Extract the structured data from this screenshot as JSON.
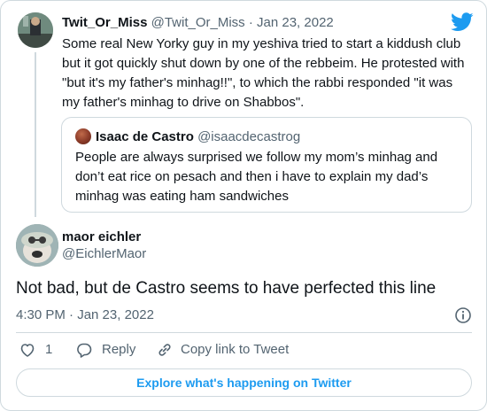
{
  "colors": {
    "accent": "#1d9bf0",
    "text": "#0f1419",
    "muted": "#536471",
    "border": "#cfd9de"
  },
  "parent": {
    "name": "Twit_Or_Miss",
    "handle": "@Twit_Or_Miss",
    "separator": "·",
    "date": "Jan 23, 2022",
    "text": "Some real New Yorky guy in my yeshiva tried to start a kiddush club but it got quickly shut down by one of the rebbeim. He protested with \"but it's my father's minhag!!\", to which the rabbi responded \"it was my father's minhag to drive on Shabbos\"."
  },
  "quote": {
    "name": "Isaac de Castro",
    "handle": "@isaacdecastrog",
    "text": "People are always surprised we follow my mom’s minhag and don’t eat rice on pesach and then i have to explain my dad’s minhag was eating ham sandwiches"
  },
  "tweet": {
    "name": "maor eichler",
    "handle": "@EichlerMaor",
    "text": "Not bad, but de Castro seems to have perfected this line",
    "time": "4:30 PM · Jan 23, 2022"
  },
  "actions": {
    "like_count": "1",
    "reply_label": "Reply",
    "copy_label": "Copy link to Tweet"
  },
  "explore_label": "Explore what's happening on Twitter",
  "icons": [
    "twitter-logo-icon",
    "heart-icon",
    "reply-icon",
    "link-icon",
    "info-icon"
  ]
}
